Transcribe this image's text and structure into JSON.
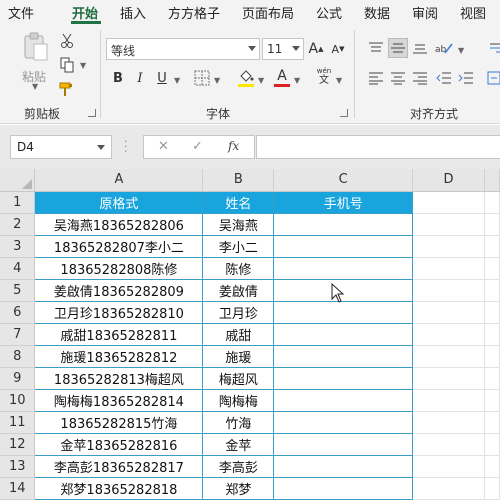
{
  "ribbon_tabs": [
    "文件",
    "开始",
    "插入",
    "方方格子",
    "页面布局",
    "公式",
    "数据",
    "审阅",
    "视图"
  ],
  "active_tab": "开始",
  "clipboard": {
    "paste_label": "粘贴",
    "group_label": "剪贴板"
  },
  "font": {
    "name": "等线",
    "size": "11",
    "group_label": "字体",
    "bold": "B",
    "italic": "I",
    "underline": "U",
    "grow": "A",
    "shrink": "A",
    "font_color_glyph": "A",
    "phonetic_top": "wén",
    "phonetic_bottom": "文",
    "fill_color": "#ffe600",
    "font_color": "#e02020"
  },
  "alignment": {
    "group_label": "对齐方式"
  },
  "formula_bar": {
    "name_box": "D4",
    "fx": "fx",
    "cancel": "✕",
    "confirm": "✓",
    "formula": ""
  },
  "columns": [
    "A",
    "B",
    "C",
    "D"
  ],
  "header_row": {
    "a": "原格式",
    "b": "姓名",
    "c": "手机号"
  },
  "rows": [
    {
      "num": "1"
    },
    {
      "num": "2",
      "a": "吴海燕18365282806",
      "b": "吴海燕"
    },
    {
      "num": "3",
      "a": "18365282807李小二",
      "b": "李小二"
    },
    {
      "num": "4",
      "a": "18365282808陈修",
      "b": "陈修"
    },
    {
      "num": "5",
      "a": "姜啟倩18365282809",
      "b": "姜啟倩"
    },
    {
      "num": "6",
      "a": "卫月珍18365282810",
      "b": "卫月珍"
    },
    {
      "num": "7",
      "a": "戚甜18365282811",
      "b": "戚甜"
    },
    {
      "num": "8",
      "a": "施瑗18365282812",
      "b": "施瑗"
    },
    {
      "num": "9",
      "a": "18365282813梅超风",
      "b": "梅超风"
    },
    {
      "num": "10",
      "a": "陶梅梅18365282814",
      "b": "陶梅梅"
    },
    {
      "num": "11",
      "a": "18365282815竹海",
      "b": "竹海"
    },
    {
      "num": "12",
      "a": "金苹18365282816",
      "b": "金苹"
    },
    {
      "num": "13",
      "a": "李高彭18365282817",
      "b": "李高彭"
    },
    {
      "num": "14",
      "a": "郑梦18365282818",
      "b": "郑梦"
    }
  ],
  "colors": {
    "accent": "#217346",
    "header_fill": "#19a4dd",
    "table_border": "#3a9fc6"
  }
}
